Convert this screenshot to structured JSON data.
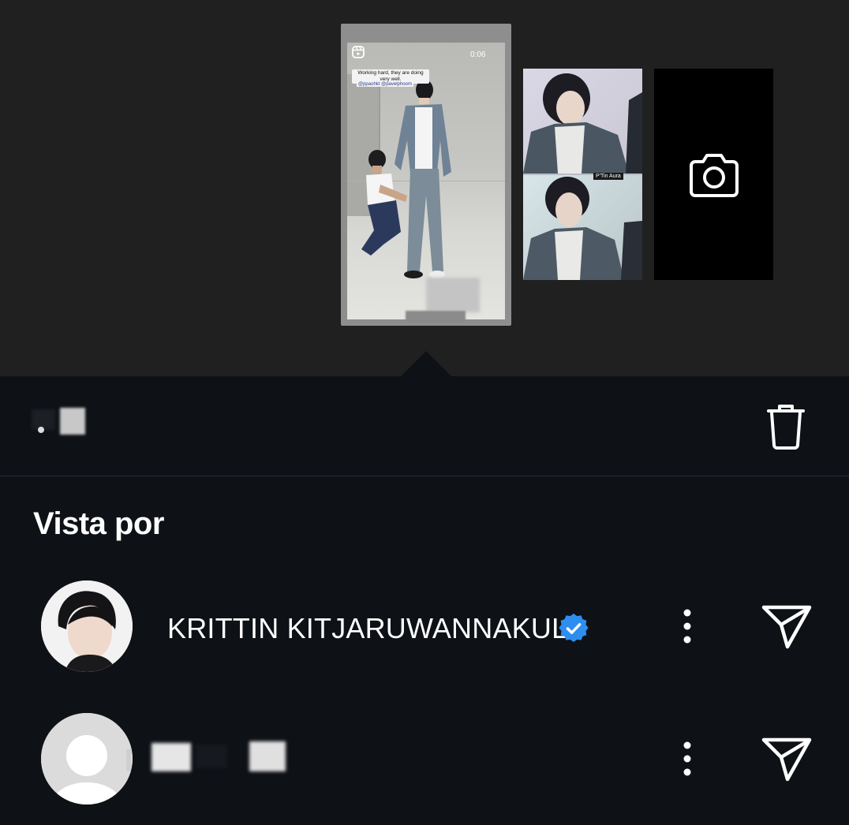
{
  "story_tray": {
    "selected_story": {
      "duration": "0:06",
      "caption": "Working hard, they are doing very well.",
      "tags": "@ppaohkt @pavelphoom"
    },
    "grid_story": {
      "tag": "P'Tin Aura"
    },
    "camera_tile": {
      "icon": "camera-icon"
    }
  },
  "sheet_header": {
    "delete_icon": "trash-icon"
  },
  "viewers": {
    "title": "Vista por",
    "items": [
      {
        "name": "KRITTIN KITJARUWANNAKUL",
        "verified": true,
        "more_icon": "more-vertical-icon",
        "send_icon": "send-icon"
      },
      {
        "name": "",
        "verified": false,
        "more_icon": "more-vertical-icon",
        "send_icon": "send-icon"
      }
    ]
  },
  "colors": {
    "sheet_bg": "#0e1116",
    "tray_bg": "#202020",
    "verified_blue": "#2d8ef0"
  }
}
